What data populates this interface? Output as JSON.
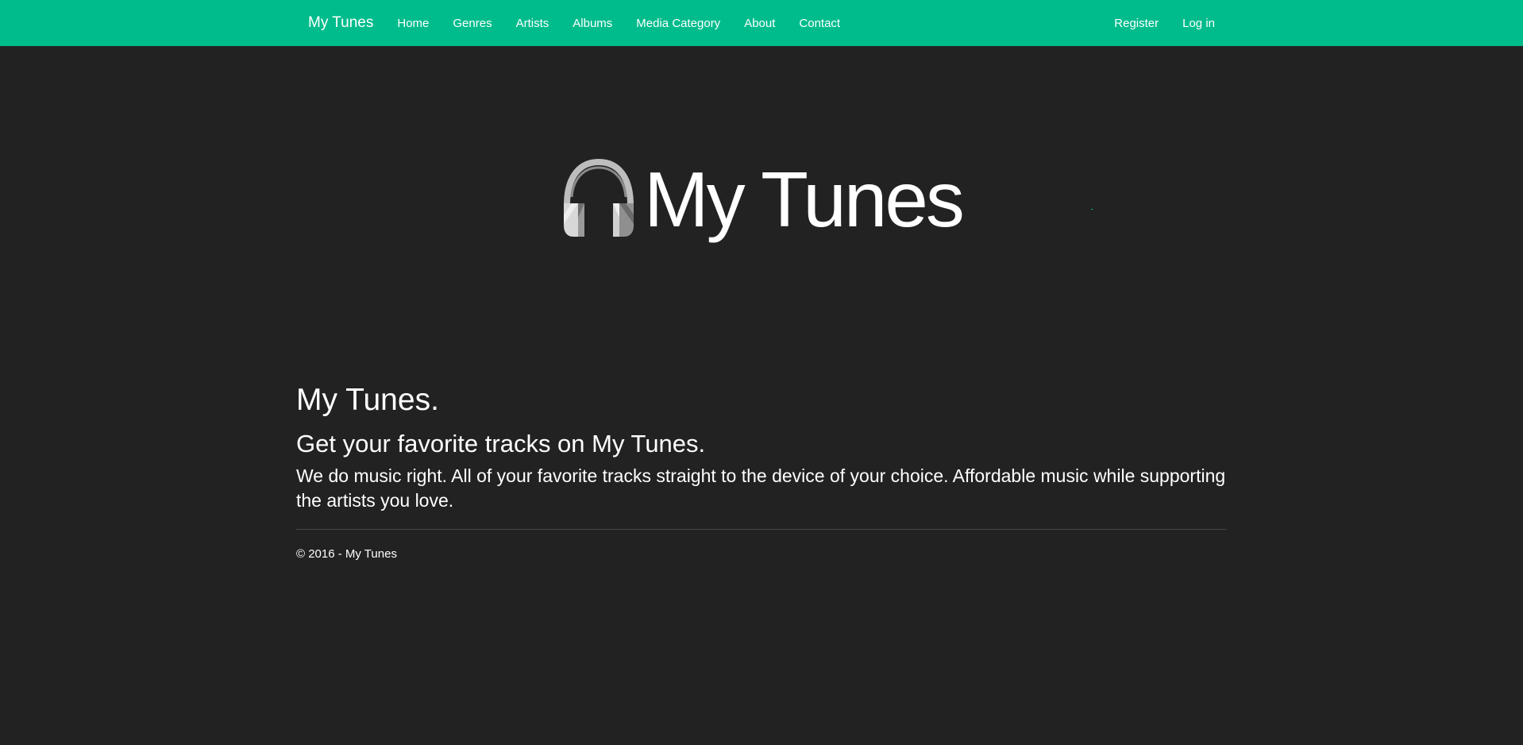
{
  "navbar": {
    "brand": "My Tunes",
    "links": [
      "Home",
      "Genres",
      "Artists",
      "Albums",
      "Media Category",
      "About",
      "Contact"
    ],
    "right_links": [
      "Register",
      "Log in"
    ],
    "color": "#00bc8c"
  },
  "hero": {
    "logo_text": "My Tunes",
    "logo_icon": "headphones-icon"
  },
  "main": {
    "heading": "My Tunes.",
    "subheading": "Get your favorite tracks on My Tunes.",
    "lead": "We do music right. All of your favorite tracks straight to the device of your choice. Affordable music while supporting the artists you love."
  },
  "footer": {
    "copyright": "© 2016 - My Tunes"
  },
  "colors": {
    "background": "#222222",
    "accent": "#00bc8c",
    "text": "#ffffff"
  }
}
